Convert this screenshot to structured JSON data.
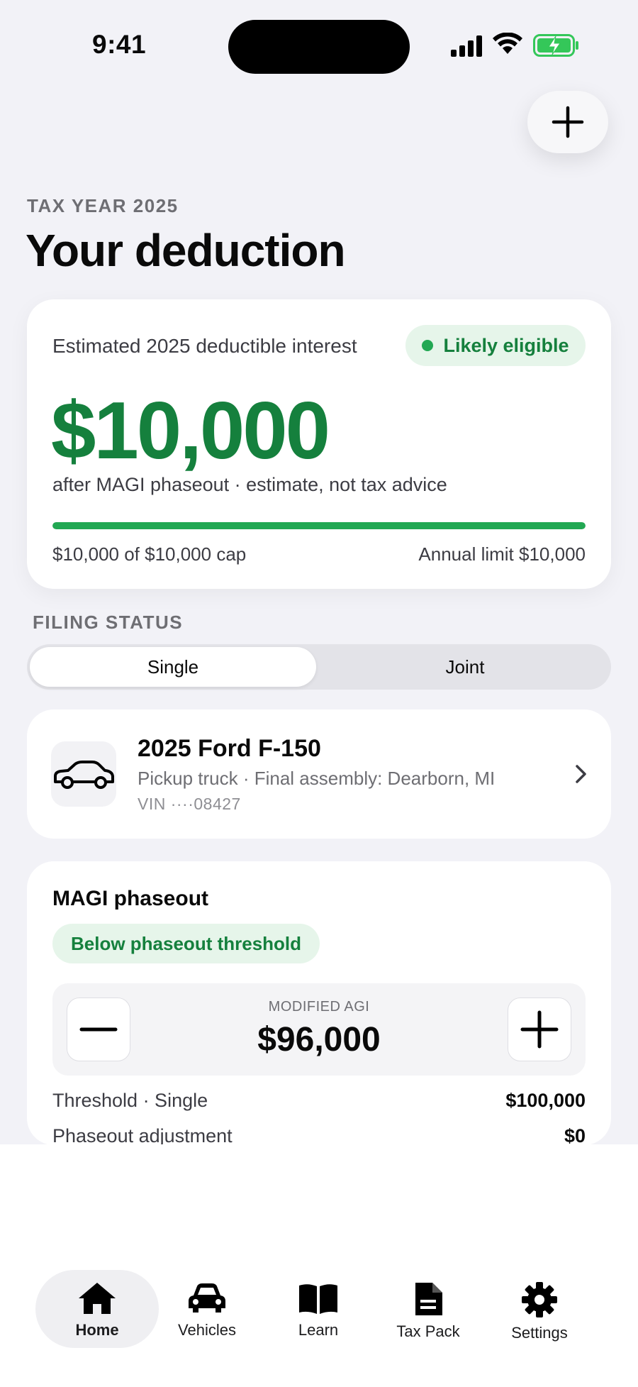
{
  "status_bar": {
    "time": "9:41"
  },
  "header": {
    "eyebrow": "TAX YEAR 2025",
    "title": "Your deduction"
  },
  "hero": {
    "label": "Estimated 2025 deductible interest",
    "eligibility_badge": "Likely eligible",
    "amount": "$10,000",
    "subtitle": "after MAGI phaseout · estimate, not tax advice",
    "progress_fraction": 1.0,
    "cap_text": "$10,000 of $10,000 cap",
    "limit_text": "Annual limit $10,000"
  },
  "filing_status": {
    "label": "FILING STATUS",
    "options": [
      "Single",
      "Joint"
    ],
    "selected": "Single"
  },
  "vehicle": {
    "title": "2025 Ford F-150",
    "subtitle": "Pickup truck · Final assembly: Dearborn, MI",
    "vin": "VIN ····08427"
  },
  "magi": {
    "title": "MAGI phaseout",
    "status_badge": "Below phaseout threshold",
    "input_label": "MODIFIED AGI",
    "input_value": "$96,000",
    "rows": [
      {
        "label": "Threshold · Single",
        "value": "$100,000"
      },
      {
        "label": "Phaseout adjustment",
        "value": "$0"
      }
    ]
  },
  "tabbar": {
    "items": [
      {
        "label": "Home",
        "icon": "house-icon",
        "active": true
      },
      {
        "label": "Vehicles",
        "icon": "car-icon",
        "active": false
      },
      {
        "label": "Learn",
        "icon": "book-icon",
        "active": false
      },
      {
        "label": "Tax Pack",
        "icon": "document-icon",
        "active": false
      },
      {
        "label": "Settings",
        "icon": "gear-icon",
        "active": false
      }
    ]
  },
  "colors": {
    "accent_green": "#15803d",
    "progress_green": "#22a853",
    "badge_bg": "#e6f5ea"
  }
}
